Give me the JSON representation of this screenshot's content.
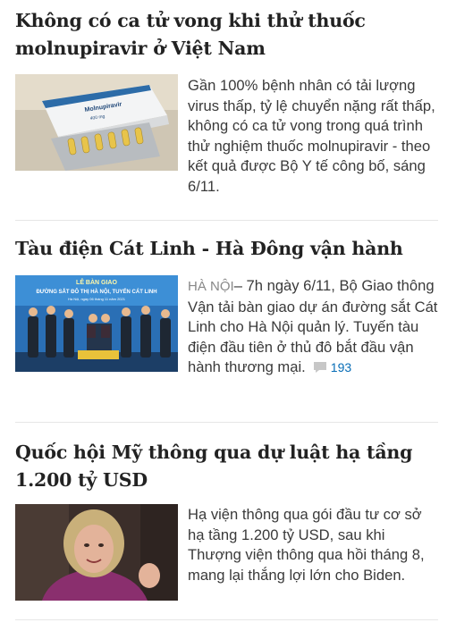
{
  "articles": [
    {
      "title": "Không có ca tử vong khi thử thuốc molnupiravir ở Việt Nam",
      "description": "Gần 100% bệnh nhân có tải lượng virus thấp, tỷ lệ chuyển nặng rất thấp, không có ca tử vong trong quá trình thử nghiệm thuốc molnupiravir - theo kết quả được Bộ Y tế công bố, sáng 6/11.",
      "image": {
        "box_text": "Molnupiravir",
        "box_subtext": "400 mg"
      }
    },
    {
      "title": "Tàu điện Cát Linh - Hà Đông vận hành",
      "location": "HÀ NỘI",
      "description": "– 7h ngày 6/11, Bộ Giao thông Vận tải bàn giao dự án đường sắt Cát Linh cho Hà Nội quản lý. Tuyến tàu điện đầu tiên ở thủ đô bắt đầu vận hành thương mại.",
      "comment_count": "193",
      "image": {
        "banner_line1": "LỄ BÀN GIAO",
        "banner_line2": "ĐƯỜNG SẮT ĐÔ THỊ HÀ NỘI, TUYẾN CÁT LINH",
        "banner_line3": "Hà Nội, ngày 06 tháng 11 năm 2021"
      }
    },
    {
      "title": "Quốc hội Mỹ thông qua dự luật hạ tầng 1.200 tỷ USD",
      "description": "Hạ viện thông qua gói đầu tư cơ sở hạ tầng 1.200 tỷ USD, sau khi Thượng viện thông qua hồi tháng 8, mang lại thắng lợi lớn cho Biden."
    }
  ],
  "colors": {
    "title": "#222222",
    "text": "#3a3a3a",
    "location": "#888888",
    "comment": "#076db6",
    "divider": "#e6e6e6"
  },
  "icons": {
    "comment": "comment-icon"
  }
}
